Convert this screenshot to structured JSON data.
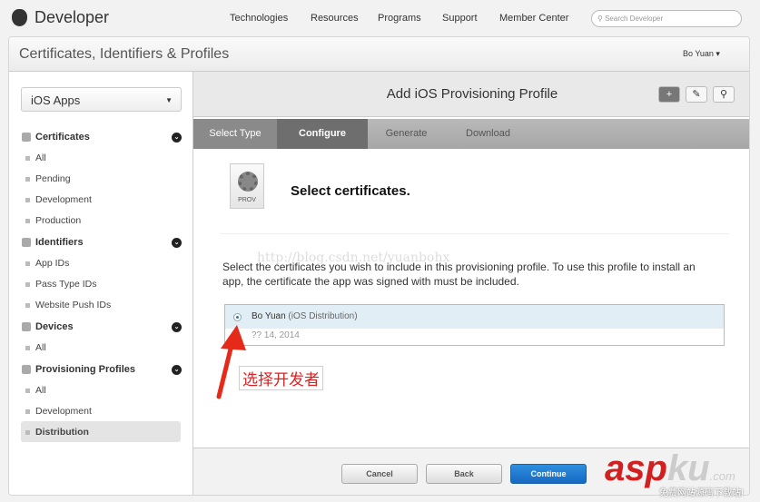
{
  "topnav": {
    "brand": "Developer",
    "links": [
      "Technologies",
      "Resources",
      "Programs",
      "Support",
      "Member Center"
    ],
    "search_placeholder": "Search Developer"
  },
  "header": {
    "title": "Certificates, Identifiers & Profiles",
    "user": "Bo Yuan ▾"
  },
  "sidebar": {
    "platform": "iOS Apps",
    "sections": [
      {
        "label": "Certificates",
        "items": [
          "All",
          "Pending",
          "Development",
          "Production"
        ]
      },
      {
        "label": "Identifiers",
        "items": [
          "App IDs",
          "Pass Type IDs",
          "Website Push IDs"
        ]
      },
      {
        "label": "Devices",
        "items": [
          "All"
        ]
      },
      {
        "label": "Provisioning Profiles",
        "items": [
          "All",
          "Development",
          "Distribution"
        ]
      }
    ],
    "selected": "Distribution"
  },
  "main": {
    "title": "Add iOS Provisioning Profile",
    "steps": [
      "Select Type",
      "Configure",
      "Generate",
      "Download"
    ],
    "current_step": "Configure",
    "icon_label": "PROV",
    "heading": "Select certificates.",
    "watermark": "http://blog.csdn.net/yuanbohx",
    "description": "Select the certificates you wish to include in this provisioning profile. To use this profile to install an app, the certificate the app was signed with must be included.",
    "certificate": {
      "name": "Bo Yuan",
      "type": "(iOS Distribution)",
      "date": "?? 14, 2014",
      "selected": true
    },
    "annotation": "选择开发者",
    "buttons": {
      "cancel": "Cancel",
      "back": "Back",
      "continue": "Continue"
    }
  },
  "site_watermark": {
    "brand_a": "asp",
    "brand_b": "ku",
    "domain": ".com",
    "tagline": "免费网站源码下载站!"
  }
}
